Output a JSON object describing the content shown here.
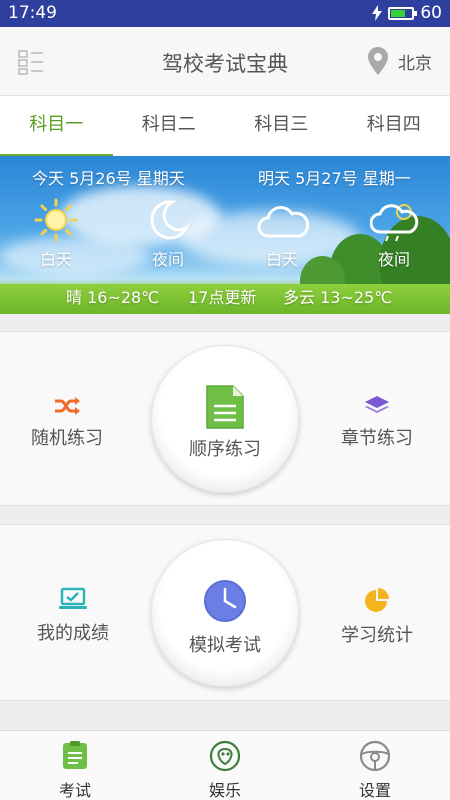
{
  "status": {
    "time": "17:49",
    "battery": "60",
    "battery_level": 0.6
  },
  "header": {
    "title": "驾校考试宝典",
    "city": "北京"
  },
  "tabs": [
    {
      "label": "科目一",
      "active": true
    },
    {
      "label": "科目二",
      "active": false
    },
    {
      "label": "科目三",
      "active": false
    },
    {
      "label": "科目四",
      "active": false
    }
  ],
  "weather": {
    "today_label": "今天 5月26号 星期天",
    "tomorrow_label": "明天 5月27号 星期一",
    "today_day": "白天",
    "today_night": "夜间",
    "tomorrow_day": "白天",
    "tomorrow_night": "夜间",
    "today_temp": "晴 16~28℃",
    "update_time": "17点更新",
    "tomorrow_temp": "多云 13~25℃"
  },
  "practice": {
    "random": "随机练习",
    "sequential": "顺序练习",
    "chapter": "章节练习"
  },
  "exam": {
    "scores": "我的成绩",
    "mock": "模拟考试",
    "stats": "学习统计"
  },
  "nav": {
    "exam": "考试",
    "entertainment": "娱乐",
    "settings": "设置"
  },
  "colors": {
    "accent": "#6cae2a",
    "status_bar": "#2f3f9e"
  }
}
